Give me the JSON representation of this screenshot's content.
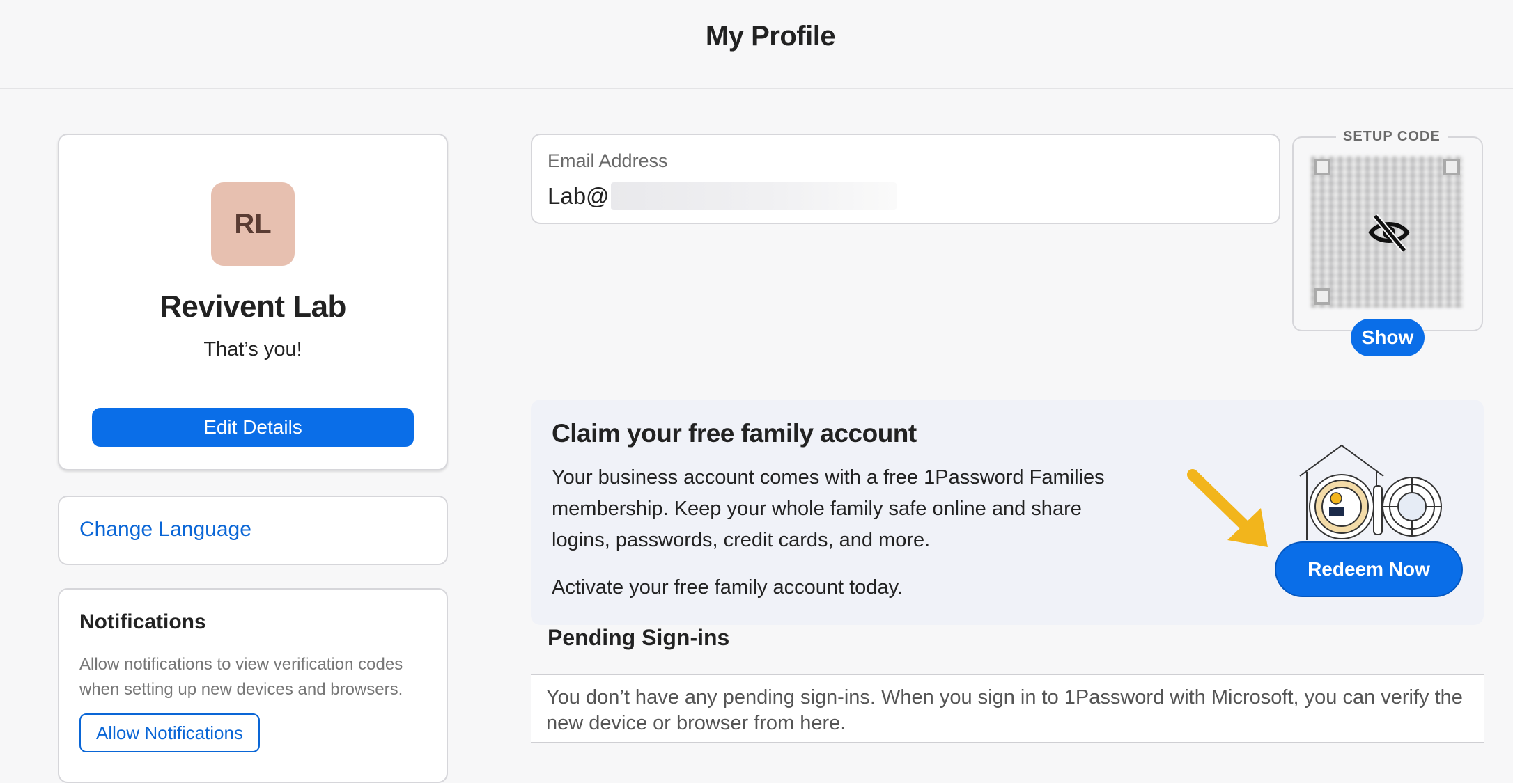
{
  "header": {
    "title": "My Profile"
  },
  "profile": {
    "initials": "RL",
    "name": "Revivent Lab",
    "subtitle": "That’s you!",
    "edit_label": "Edit Details"
  },
  "language": {
    "link_label": "Change Language"
  },
  "notifications": {
    "title": "Notifications",
    "description": "Allow notifications to view verification codes when setting up new devices and browsers.",
    "button_label": "Allow Notifications"
  },
  "email": {
    "label": "Email Address",
    "value_visible": "Lab@"
  },
  "setup_code": {
    "label": "SETUP CODE",
    "show_label": "Show"
  },
  "family": {
    "title": "Claim your free family account",
    "body": "Your business account comes with a free 1Password Families membership. Keep your whole family safe online and share logins, passwords, credit cards, and more.",
    "cta_text": "Activate your free family account today.",
    "button_label": "Redeem Now"
  },
  "pending": {
    "title": "Pending Sign-ins",
    "message": "You don’t have any pending sign-ins. When you sign in to 1Password with Microsoft, you can verify the new device or browser from here."
  },
  "colors": {
    "accent": "#0a6ee8",
    "link": "#0a66d6",
    "avatar_bg": "#e7c0b0",
    "arrow": "#f2b51c"
  },
  "icons": [
    "eye-off-icon",
    "arrow-annotation-icon",
    "house-vault-illustration"
  ]
}
